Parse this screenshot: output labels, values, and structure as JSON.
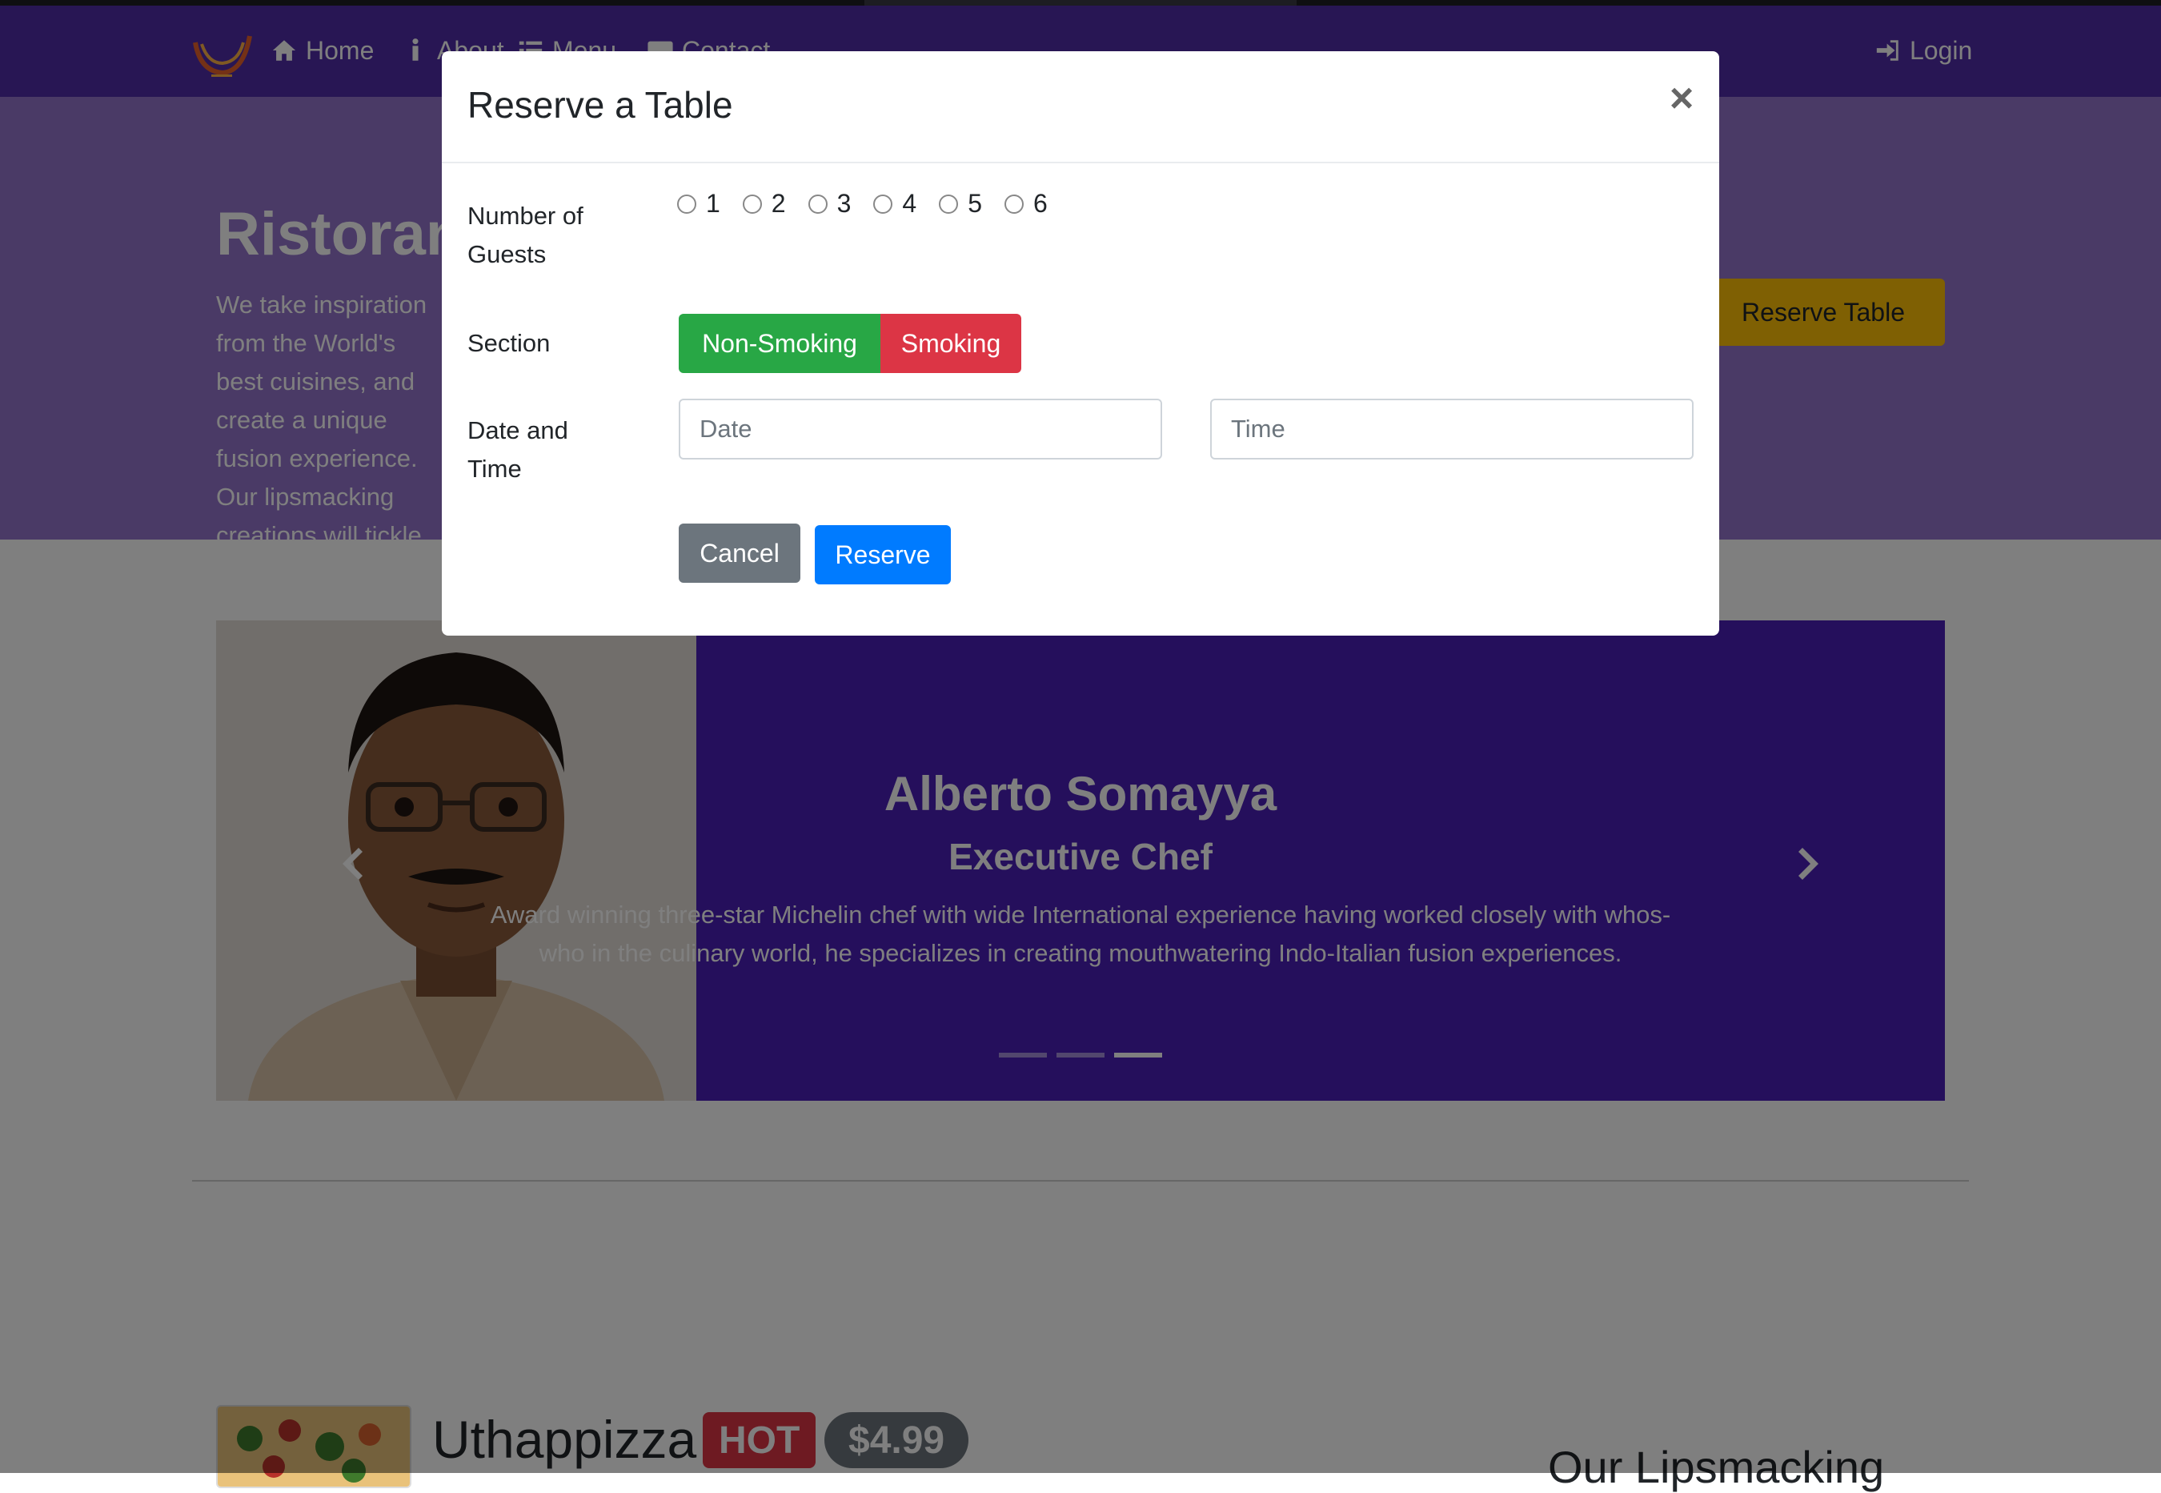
{
  "navbar": {
    "links": [
      {
        "label": "Home",
        "icon": "home-icon"
      },
      {
        "label": "About",
        "icon": "info-icon"
      },
      {
        "label": "Menu",
        "icon": "list-icon"
      },
      {
        "label": "Contact",
        "icon": "address-card-icon"
      }
    ],
    "login_label": "Login",
    "brand_color": "#512da8"
  },
  "hero": {
    "title": "Ristorante con Fusion",
    "text": "We take inspiration from the World's best cuisines, and create a unique fusion experience. Our lipsmacking creations will tickle your culinary senses!",
    "reserve_label": "Reserve Table",
    "background": "#9575cd"
  },
  "carousel": {
    "name": "Alberto Somayya",
    "role": "Executive Chef",
    "text": "Award winning three-star Michelin chef with wide International experience having worked closely with whos-who in the culinary world, he specializes in creating mouthwatering Indo-Italian fusion experiences.",
    "slides": 3,
    "active_slide": 3
  },
  "dish": {
    "name": "Uthappizza",
    "badge": "HOT",
    "price": "$4.99"
  },
  "side_heading": "Our Lipsmacking",
  "modal": {
    "title": "Reserve a Table",
    "close_label": "×",
    "guests_label": "Number of Guests",
    "guest_options": [
      "1",
      "2",
      "3",
      "4",
      "5",
      "6"
    ],
    "section_label": "Section",
    "section_options": [
      {
        "label": "Non-Smoking",
        "color": "#28a745"
      },
      {
        "label": "Smoking",
        "color": "#dc3545"
      }
    ],
    "datetime_label": "Date and Time",
    "date_placeholder": "Date",
    "time_placeholder": "Time",
    "cancel_label": "Cancel",
    "reserve_label": "Reserve"
  }
}
